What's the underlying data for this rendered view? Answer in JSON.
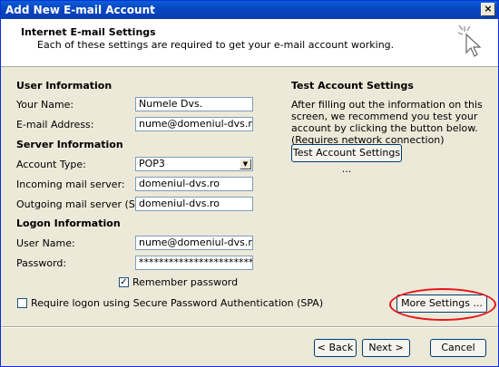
{
  "window": {
    "title": "Add New E-mail Account",
    "close_label": "×"
  },
  "header": {
    "title": "Internet E-mail Settings",
    "subtitle": "Each of these settings are required to get your e-mail account working."
  },
  "user_info": {
    "heading": "User Information",
    "name_label": "Your Name:",
    "name_value": "Numele Dvs.",
    "email_label": "E-mail Address:",
    "email_value": "nume@domeniul-dvs.ro"
  },
  "server_info": {
    "heading": "Server Information",
    "account_type_label": "Account Type:",
    "account_type_value": "POP3",
    "incoming_label": "Incoming mail server:",
    "incoming_value": "domeniul-dvs.ro",
    "outgoing_label": "Outgoing mail server (SMTP):",
    "outgoing_value": "domeniul-dvs.ro"
  },
  "logon_info": {
    "heading": "Logon Information",
    "username_label": "User Name:",
    "username_value": "nume@domeniul-dvs.ro",
    "password_label": "Password:",
    "password_value": "************************",
    "remember_label": "Remember password",
    "remember_checked": true,
    "spa_label": "Require logon using Secure Password Authentication (SPA)",
    "spa_checked": false
  },
  "test": {
    "heading": "Test Account Settings",
    "description": "After filling out the information on this screen, we recommend you test your account by clicking the button below. (Requires network connection)",
    "button_label": "Test Account Settings ..."
  },
  "more_settings_label": "More Settings ...",
  "nav": {
    "back_label": "< Back",
    "next_label": "Next >",
    "cancel_label": "Cancel"
  },
  "colors": {
    "highlight_ring": "#e8141a",
    "titlebar": "#0846c2"
  }
}
